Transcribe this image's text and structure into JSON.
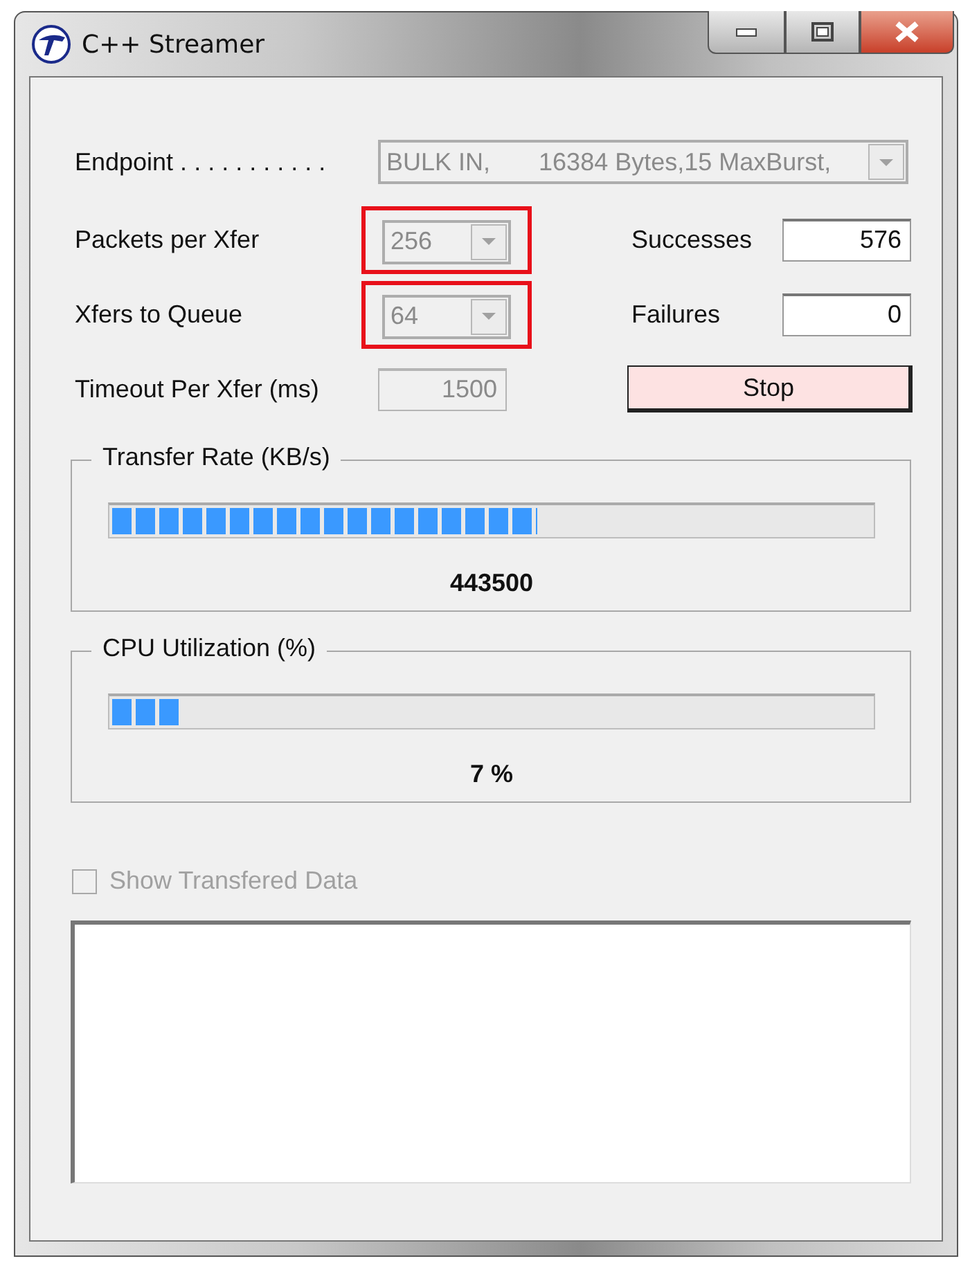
{
  "window": {
    "title": "C++ Streamer"
  },
  "endpoint": {
    "label": "Endpoint . . . . . . . . . . .",
    "value": "BULK IN,       16384 Bytes,15 MaxBurst,",
    "disabled": true
  },
  "packets_per_xfer": {
    "label": "Packets per Xfer",
    "value": "256",
    "disabled": true,
    "highlighted": true
  },
  "xfers_to_queue": {
    "label": "Xfers to Queue",
    "value": "64",
    "disabled": true,
    "highlighted": true
  },
  "timeout": {
    "label": "Timeout Per Xfer (ms)",
    "value": "1500",
    "disabled": true
  },
  "successes": {
    "label": "Successes",
    "value": "576"
  },
  "failures": {
    "label": "Failures",
    "value": "0"
  },
  "stop_button": {
    "label": "Stop"
  },
  "meters": [
    {
      "title": "Transfer Rate (KB/s)",
      "level": 0.56,
      "reading": "443500"
    },
    {
      "title": "CPU Utilization (%)",
      "level": 0.09,
      "reading": "7 %"
    }
  ],
  "show_data": {
    "label": "Show Transfered Data",
    "checked": false,
    "disabled": true
  }
}
